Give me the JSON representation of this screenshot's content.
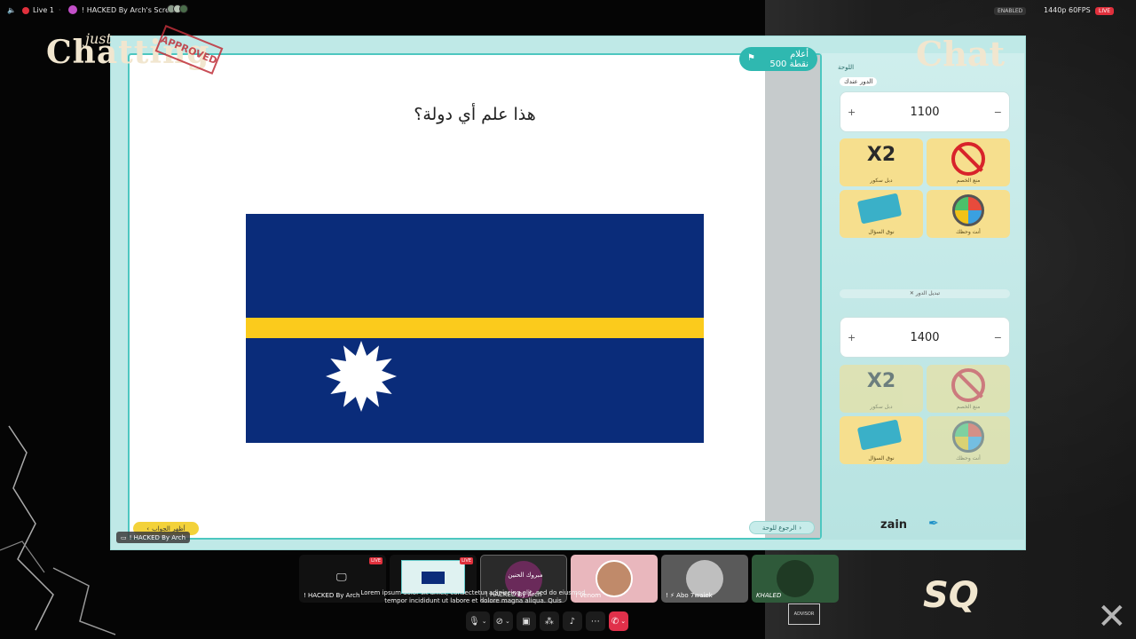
{
  "topbar": {
    "live_label": "Live 1",
    "screen_label": "! HACKED By Arch's Screen",
    "enabled_label": "ENABLED",
    "quality_label": "1440p 60FPS",
    "live_badge": "LIVE"
  },
  "overlay": {
    "logo_just": "just",
    "logo_chatting": "Chatting",
    "logo_stamp": "APPROVED",
    "logo_chat": "Chat"
  },
  "slide": {
    "question": "هذا علم أي دولة؟",
    "topic_badge_line1": "أعلام",
    "topic_badge_line2": "500 نقطة",
    "show_answer_button": "أظهر الجواب",
    "back_button": "الرجوع للوحة",
    "presenter_tag": "! HACKED By Arch"
  },
  "flag_colors": {
    "blue": "#0a2c7a",
    "yellow": "#fbcb1c",
    "star": "#ffffff"
  },
  "side_panel": {
    "board_label": "اللوحة",
    "turn_label": "الدور عندك",
    "team1_score": "1100",
    "team2_score": "1400",
    "plus": "+",
    "minus": "−",
    "switch_turn": "تبديل الدور",
    "powerups": [
      {
        "glyph": "X2",
        "label": "دبل سكور",
        "icon": "double-score-icon"
      },
      {
        "glyph": "",
        "label": "منع الخصم",
        "icon": "block-opponent-icon"
      },
      {
        "glyph": "",
        "label": "نوق السؤال",
        "icon": "cards-icon"
      },
      {
        "glyph": "",
        "label": "أنت وحظك",
        "icon": "wheel-icon"
      }
    ],
    "sponsor": "zain"
  },
  "participants": [
    {
      "name": "! HACKED By Arch",
      "live": "LIVE"
    },
    {
      "name": "",
      "live": "LIVE"
    },
    {
      "name": "! HACKED By Arch",
      "badge": "مبروك الحنين"
    },
    {
      "name": "! Venom"
    },
    {
      "name": "! ⚡ Abo 7waiek"
    },
    {
      "name": "KHALED"
    }
  ],
  "chat_overlay": "Lorem ipsum dolor sit amet, consectetur adipiscing elit, sed do eiusmod tempor incididunt ut labore et dolore magna aliqua. Quis",
  "bottom_logos": {
    "sq": "SQ",
    "adv": "ADVISOR"
  }
}
